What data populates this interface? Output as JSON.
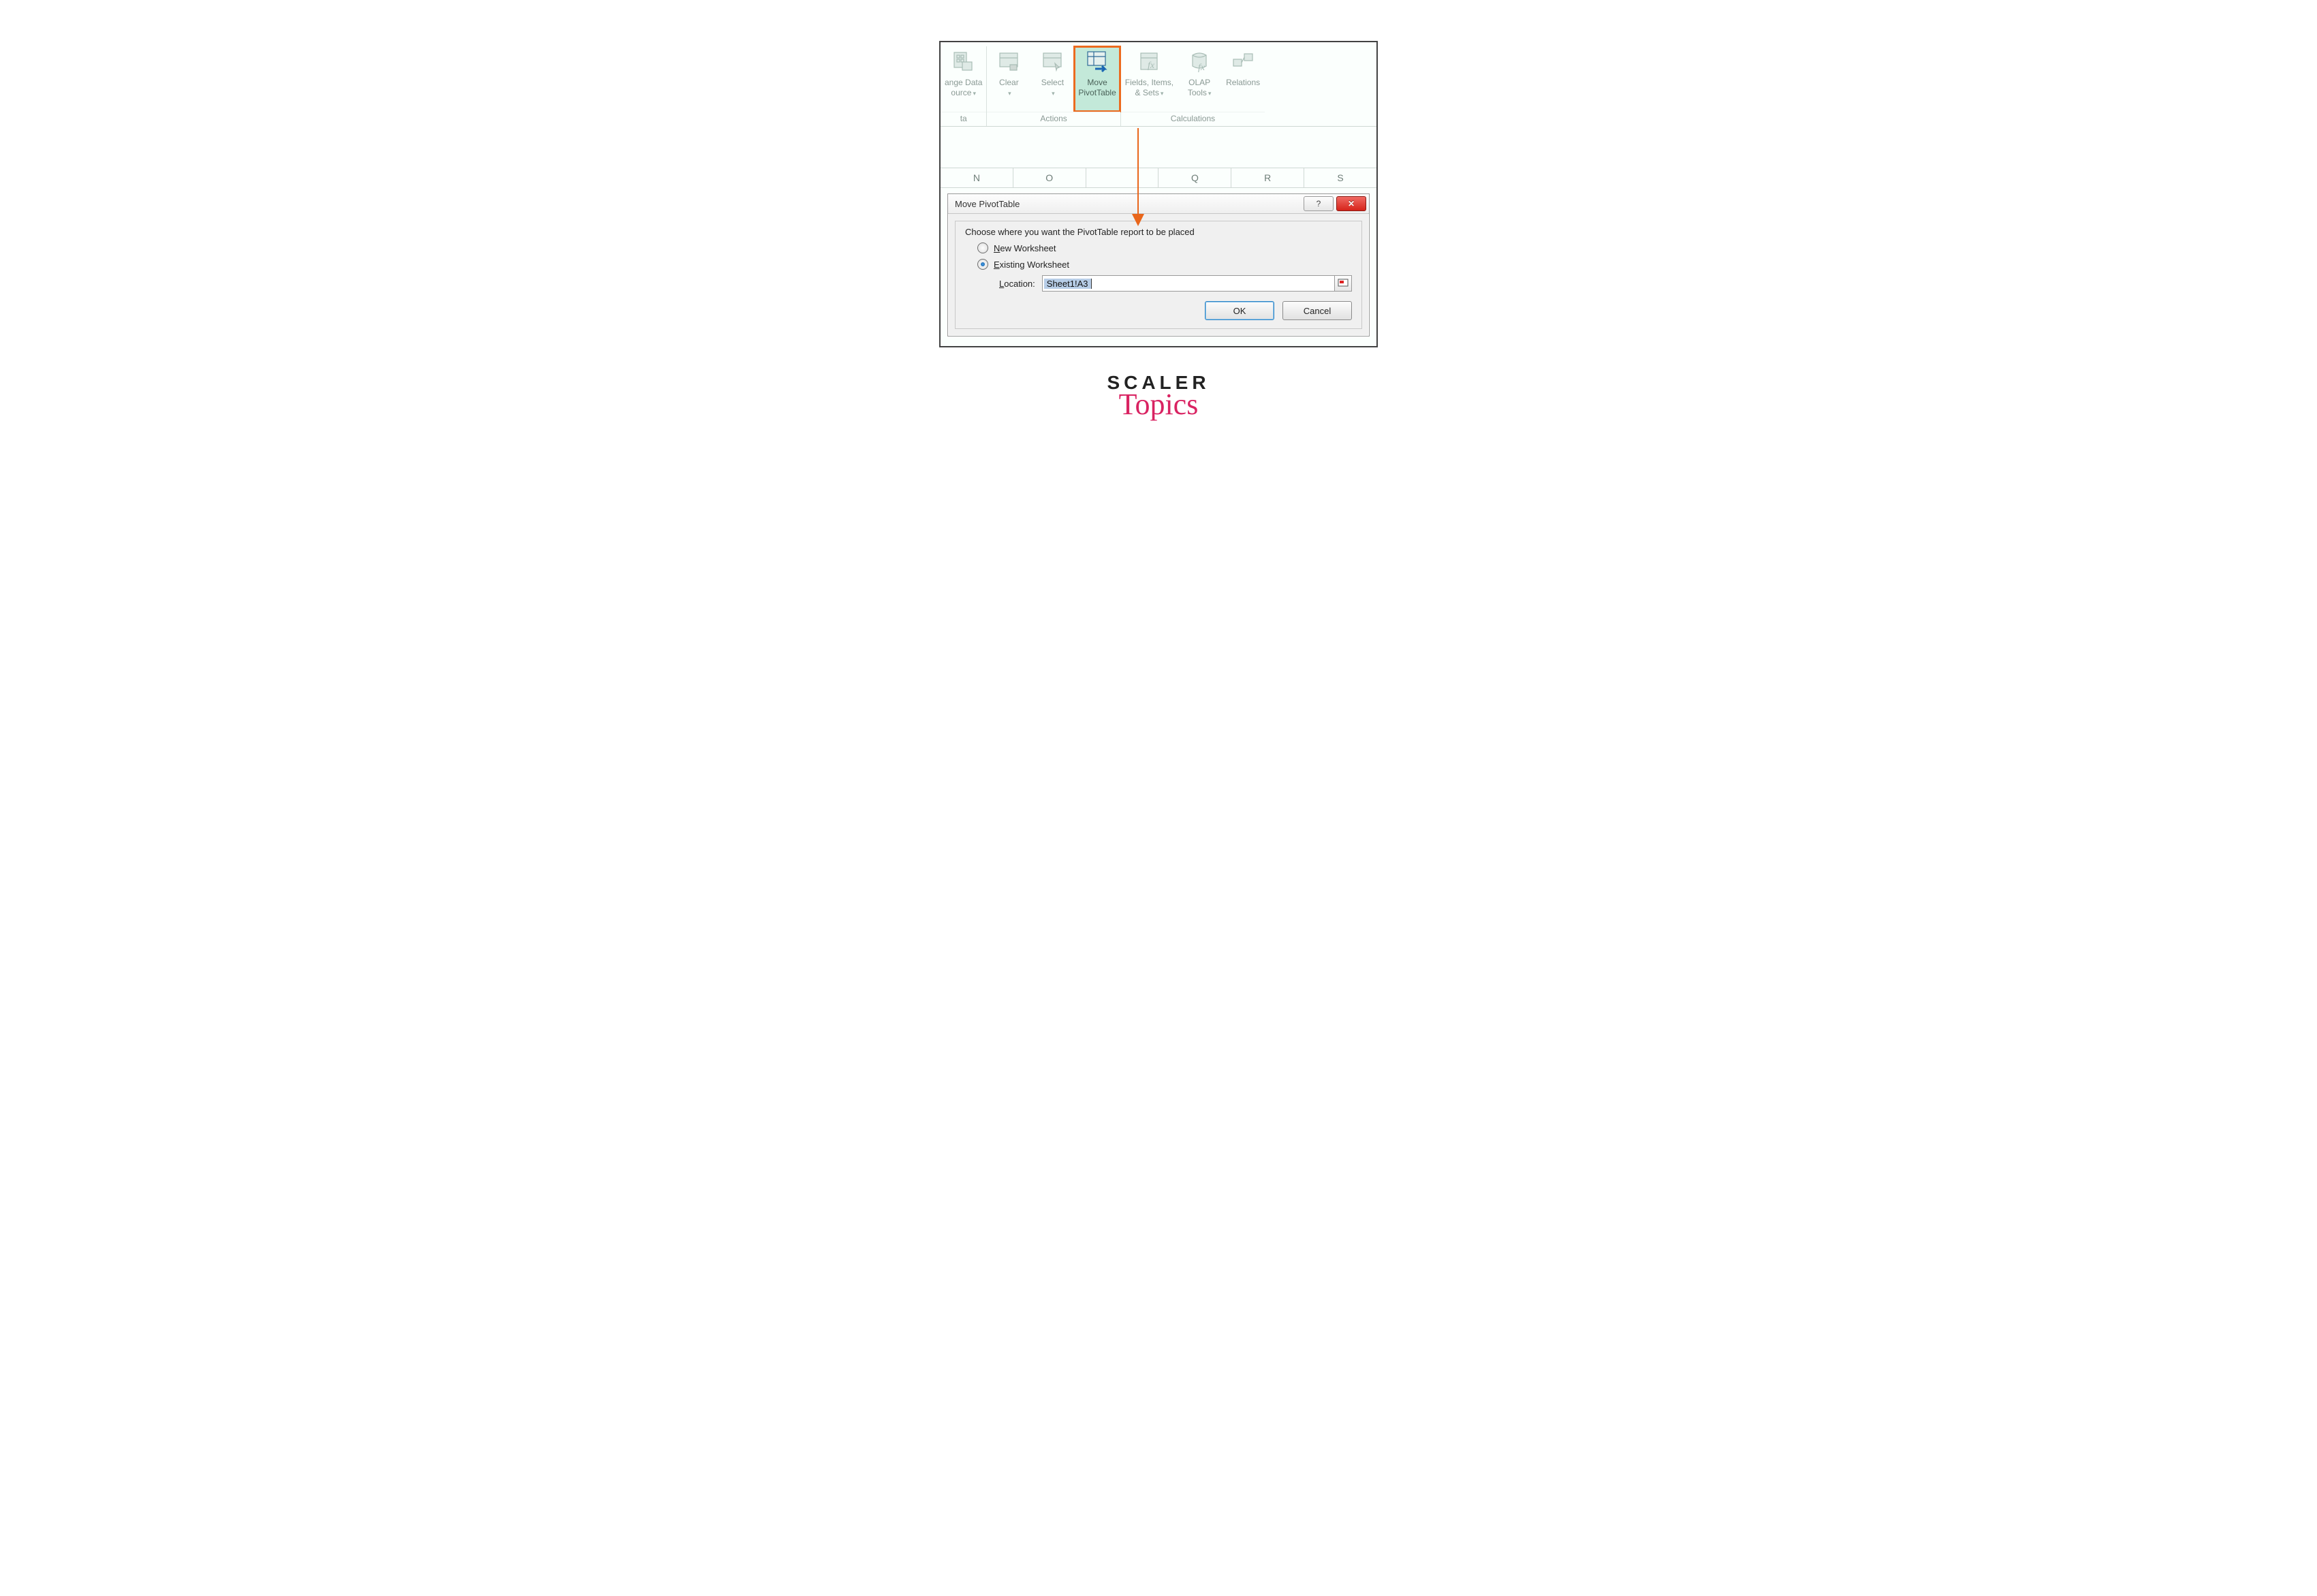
{
  "ribbon": {
    "groups": [
      {
        "label": "ta",
        "buttons": [
          {
            "id": "change-data-source",
            "line1": "ange Data",
            "line2": "ource",
            "hasDropdown": true
          }
        ]
      },
      {
        "label": "Actions",
        "buttons": [
          {
            "id": "clear",
            "line1": "Clear",
            "line2": "",
            "hasDropdown": true
          },
          {
            "id": "select",
            "line1": "Select",
            "line2": "",
            "hasDropdown": true
          },
          {
            "id": "move-pivottable",
            "line1": "Move",
            "line2": "PivotTable",
            "hasDropdown": false,
            "highlight": true
          }
        ]
      },
      {
        "label": "Calculations",
        "buttons": [
          {
            "id": "fields-items-sets",
            "line1": "Fields, Items,",
            "line2": "& Sets",
            "hasDropdown": true
          },
          {
            "id": "olap-tools",
            "line1": "OLAP",
            "line2": "Tools",
            "hasDropdown": true
          },
          {
            "id": "relations",
            "line1": "Relations",
            "line2": "",
            "hasDropdown": false
          }
        ]
      }
    ]
  },
  "columns": [
    "N",
    "O",
    "",
    "Q",
    "R",
    "S"
  ],
  "dialog": {
    "title": "Move PivotTable",
    "group_label": "Choose where you want the PivotTable report to be placed",
    "option_new": "New Worksheet",
    "option_existing": "Existing Worksheet",
    "location_label": "Location:",
    "location_value": "Sheet1!A3",
    "ok": "OK",
    "cancel": "Cancel"
  },
  "brand": {
    "line1": "SCALER",
    "line2": "Topics"
  }
}
